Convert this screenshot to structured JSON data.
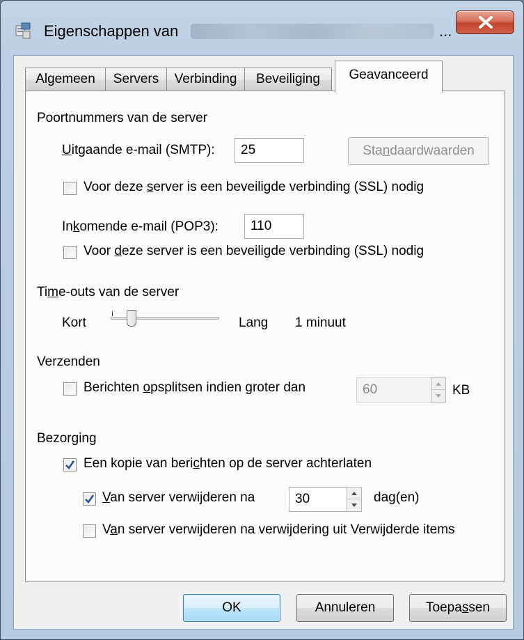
{
  "window": {
    "title_prefix": "Eigenschappen van",
    "title_ellipsis": "..."
  },
  "tabs": [
    {
      "label": "Algemeen",
      "active": false
    },
    {
      "label": "Servers",
      "active": false
    },
    {
      "label": "Verbinding",
      "active": false
    },
    {
      "label": "Beveiliging",
      "active": false
    },
    {
      "label": "Geavanceerd",
      "active": true
    }
  ],
  "ports": {
    "group_label": "Poortnummers van de server",
    "smtp_label_hot": "U",
    "smtp_label_rest": "itgaande e-mail (SMTP):",
    "smtp_value": "25",
    "defaults_button_pre": "Sta",
    "defaults_button_hot": "n",
    "defaults_button_post": "daardwaarden",
    "smtp_ssl_pre": "Voor deze ",
    "smtp_ssl_hot": "s",
    "smtp_ssl_post": "erver is een beveiligde verbinding (SSL) nodig",
    "smtp_ssl_checked": false,
    "pop3_label_pre": "In",
    "pop3_label_hot": "k",
    "pop3_label_post": "omende e-mail (POP3):",
    "pop3_value": "110",
    "pop3_ssl_pre": "Voor ",
    "pop3_ssl_hot": "d",
    "pop3_ssl_post": "eze server is een beveiligde verbinding (SSL) nodig",
    "pop3_ssl_checked": false
  },
  "timeouts": {
    "group_label_pre": "Ti",
    "group_label_hot": "m",
    "group_label_post": "e-outs van de server",
    "short_label": "Kort",
    "long_label": "Lang",
    "value_text": "1 minuut",
    "slider_fraction": 0.17
  },
  "sending": {
    "group_label": "Verzenden",
    "split_pre": "Berichten ",
    "split_hot": "o",
    "split_mid": "psplitsen indien ",
    "split_hot2": "g",
    "split_post": "roter dan",
    "split_checked": false,
    "split_value": "60",
    "split_unit": "KB"
  },
  "delivery": {
    "group_label": "Bezorging",
    "keep_copy_pre": "Een kopie van beri",
    "keep_copy_hot": "c",
    "keep_copy_post": "hten op de server achterlaten",
    "keep_copy_checked": true,
    "remove_after_hot": "V",
    "remove_after_rest": "an server verwijderen na",
    "remove_after_checked": true,
    "remove_after_value": "30",
    "remove_after_unit": "dag(en)",
    "remove_deleted_pre": "V",
    "remove_deleted_hot": "a",
    "remove_deleted_post": "n server verwijderen na verwijdering uit Verwijderde items",
    "remove_deleted_checked": false
  },
  "buttons": {
    "ok": "OK",
    "cancel": "Annuleren",
    "apply_pre": "Toepa",
    "apply_hot": "s",
    "apply_post": "sen"
  },
  "colors": {
    "title_gradient_top": "#c3d4e7",
    "close_button": "#c0432a",
    "default_button": "#a7d9f5",
    "checkmark": "#2a4f9a"
  }
}
